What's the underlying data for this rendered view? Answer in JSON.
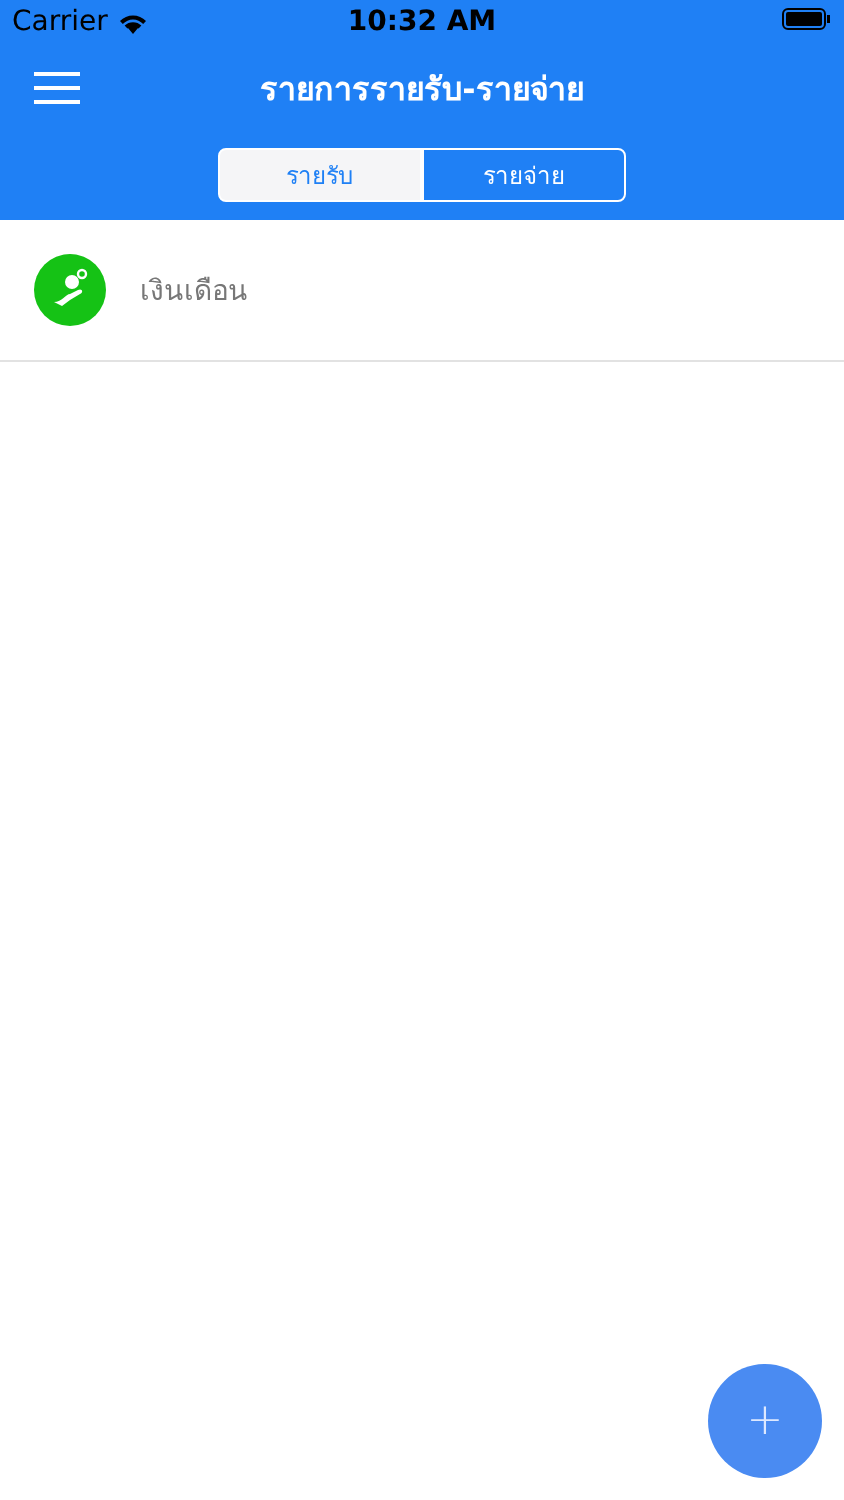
{
  "status_bar": {
    "carrier": "Carrier",
    "time": "10:32 AM"
  },
  "nav": {
    "title": "รายการรายรับ-รายจ่าย"
  },
  "tabs": [
    {
      "label": "รายรับ",
      "selected": true
    },
    {
      "label": "รายจ่าย",
      "selected": false
    }
  ],
  "items": [
    {
      "label": "เงินเดือน",
      "color": "#15c215"
    }
  ],
  "fab": {
    "label": "+"
  }
}
